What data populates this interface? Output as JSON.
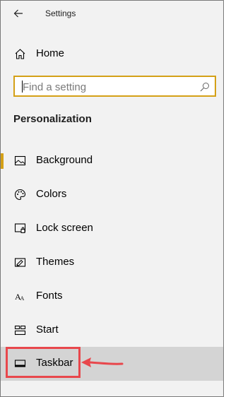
{
  "window": {
    "title": "Settings"
  },
  "home": {
    "label": "Home"
  },
  "search": {
    "placeholder": "Find a setting"
  },
  "section": {
    "title": "Personalization"
  },
  "nav": {
    "items": [
      {
        "label": "Background",
        "icon": "background-icon"
      },
      {
        "label": "Colors",
        "icon": "palette-icon"
      },
      {
        "label": "Lock screen",
        "icon": "lock-screen-icon"
      },
      {
        "label": "Themes",
        "icon": "themes-icon"
      },
      {
        "label": "Fonts",
        "icon": "fonts-icon"
      },
      {
        "label": "Start",
        "icon": "start-icon"
      },
      {
        "label": "Taskbar",
        "icon": "taskbar-icon"
      }
    ]
  },
  "colors": {
    "accent": "#d4a017",
    "annotation": "#e8474c",
    "hover": "#d4d4d4"
  }
}
